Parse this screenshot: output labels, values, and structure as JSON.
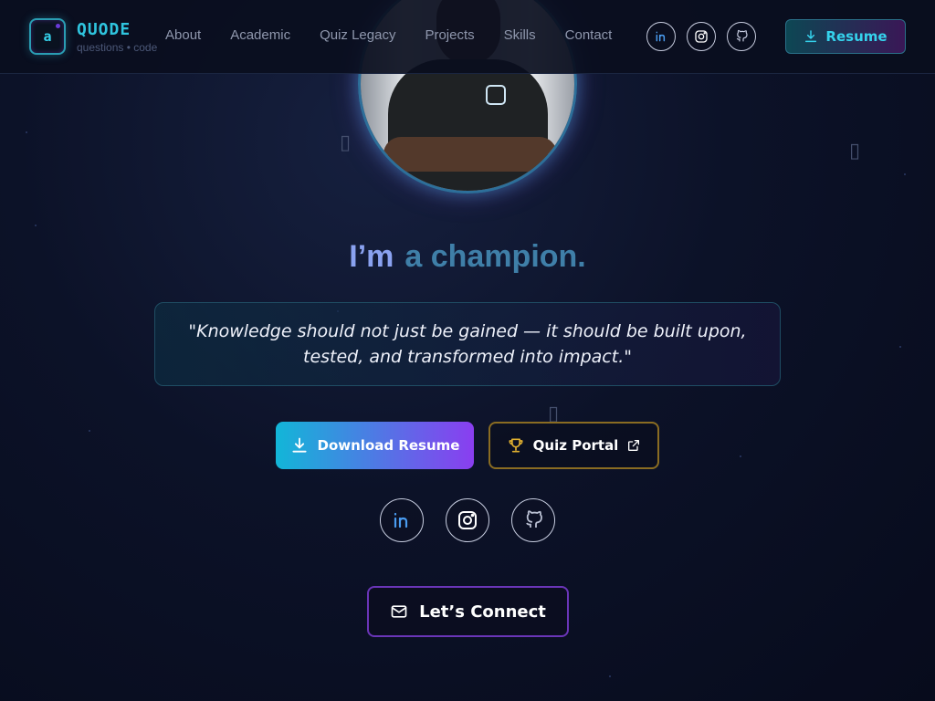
{
  "brand": {
    "logo_letter": "a",
    "name": "QUODE",
    "tagline": "questions • code"
  },
  "nav": [
    "About",
    "Academic",
    "Quiz Legacy",
    "Projects",
    "Skills",
    "Contact"
  ],
  "header_social": [
    {
      "name": "linkedin-icon",
      "color": "#4a9cf0"
    },
    {
      "name": "instagram-icon",
      "color": "#ffffff"
    },
    {
      "name": "github-icon",
      "color": "#c5cbe0"
    }
  ],
  "resume_button": {
    "label": "Resume",
    "icon": "download-icon"
  },
  "hero": {
    "prefix": "I’m",
    "rotating_word": "a champion.",
    "quote": "\"Knowledge should not just be gained — it should be built upon, tested, and transformed into impact.\""
  },
  "cta": {
    "download": {
      "label": "Download Resume",
      "icon": "download-icon"
    },
    "quiz": {
      "label": "Quiz Portal",
      "icon": "trophy-icon",
      "trailing_icon": "external-link-icon"
    }
  },
  "social_links": [
    "linkedin-icon",
    "instagram-icon",
    "github-icon"
  ],
  "connect": {
    "label": "Let’s Connect",
    "icon": "mail-icon"
  },
  "colors": {
    "accent_cyan": "#2fc4de",
    "accent_purple": "#8a3ef0",
    "gold": "#e0b030"
  }
}
